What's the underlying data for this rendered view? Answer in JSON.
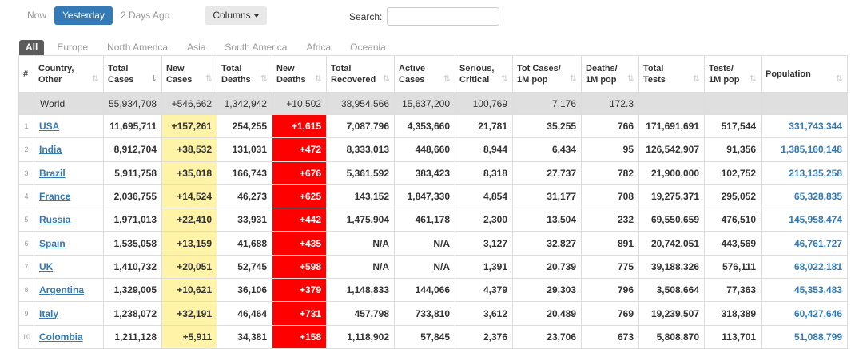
{
  "filters": {
    "now": "Now",
    "yesterday": "Yesterday",
    "two_days": "2 Days Ago",
    "columns": "Columns"
  },
  "search": {
    "label": "Search:",
    "value": ""
  },
  "tabs": [
    "All",
    "Europe",
    "North America",
    "Asia",
    "South America",
    "Africa",
    "Oceania"
  ],
  "headers": [
    {
      "l1": "#",
      "l2": ""
    },
    {
      "l1": "Country,",
      "l2": "Other"
    },
    {
      "l1": "Total",
      "l2": "Cases"
    },
    {
      "l1": "New",
      "l2": "Cases"
    },
    {
      "l1": "Total",
      "l2": "Deaths"
    },
    {
      "l1": "New",
      "l2": "Deaths"
    },
    {
      "l1": "Total",
      "l2": "Recovered"
    },
    {
      "l1": "Active",
      "l2": "Cases"
    },
    {
      "l1": "Serious,",
      "l2": "Critical"
    },
    {
      "l1": "Tot Cases/",
      "l2": "1M pop"
    },
    {
      "l1": "Deaths/",
      "l2": "1M pop"
    },
    {
      "l1": "Total",
      "l2": "Tests"
    },
    {
      "l1": "Tests/",
      "l2": "1M pop"
    },
    {
      "l1": "Population",
      "l2": ""
    }
  ],
  "world": [
    "",
    "World",
    "55,934,708",
    "+546,662",
    "1,342,942",
    "+10,502",
    "38,954,566",
    "15,637,200",
    "100,769",
    "7,176",
    "172.3",
    "",
    "",
    ""
  ],
  "rows": [
    [
      "1",
      "USA",
      "11,695,711",
      "+157,261",
      "254,255",
      "+1,615",
      "7,087,796",
      "4,353,660",
      "21,781",
      "35,255",
      "766",
      "171,691,691",
      "517,544",
      "331,743,344"
    ],
    [
      "2",
      "India",
      "8,912,704",
      "+38,532",
      "131,031",
      "+472",
      "8,333,013",
      "448,660",
      "8,944",
      "6,434",
      "95",
      "126,542,907",
      "91,356",
      "1,385,160,148"
    ],
    [
      "3",
      "Brazil",
      "5,911,758",
      "+35,018",
      "166,743",
      "+676",
      "5,361,592",
      "383,423",
      "8,318",
      "27,737",
      "782",
      "21,900,000",
      "102,752",
      "213,135,258"
    ],
    [
      "4",
      "France",
      "2,036,755",
      "+14,524",
      "46,273",
      "+625",
      "143,152",
      "1,847,330",
      "4,854",
      "31,177",
      "708",
      "19,275,371",
      "295,052",
      "65,328,835"
    ],
    [
      "5",
      "Russia",
      "1,971,013",
      "+22,410",
      "33,931",
      "+442",
      "1,475,904",
      "461,178",
      "2,300",
      "13,504",
      "232",
      "69,550,659",
      "476,510",
      "145,958,474"
    ],
    [
      "6",
      "Spain",
      "1,535,058",
      "+13,159",
      "41,688",
      "+435",
      "N/A",
      "N/A",
      "3,127",
      "32,827",
      "891",
      "20,742,051",
      "443,569",
      "46,761,727"
    ],
    [
      "7",
      "UK",
      "1,410,732",
      "+20,051",
      "52,745",
      "+598",
      "N/A",
      "N/A",
      "1,391",
      "20,739",
      "775",
      "39,188,326",
      "576,111",
      "68,022,181"
    ],
    [
      "8",
      "Argentina",
      "1,329,005",
      "+10,621",
      "36,106",
      "+379",
      "1,148,833",
      "144,066",
      "4,379",
      "29,303",
      "796",
      "3,508,664",
      "77,363",
      "45,353,483"
    ],
    [
      "9",
      "Italy",
      "1,238,072",
      "+32,191",
      "46,464",
      "+731",
      "457,798",
      "733,810",
      "3,612",
      "20,489",
      "769",
      "19,239,507",
      "318,389",
      "60,427,646"
    ],
    [
      "10",
      "Colombia",
      "1,211,128",
      "+5,911",
      "34,381",
      "+158",
      "1,118,902",
      "57,845",
      "2,376",
      "23,706",
      "673",
      "5,808,870",
      "113,701",
      "51,088,799"
    ]
  ]
}
